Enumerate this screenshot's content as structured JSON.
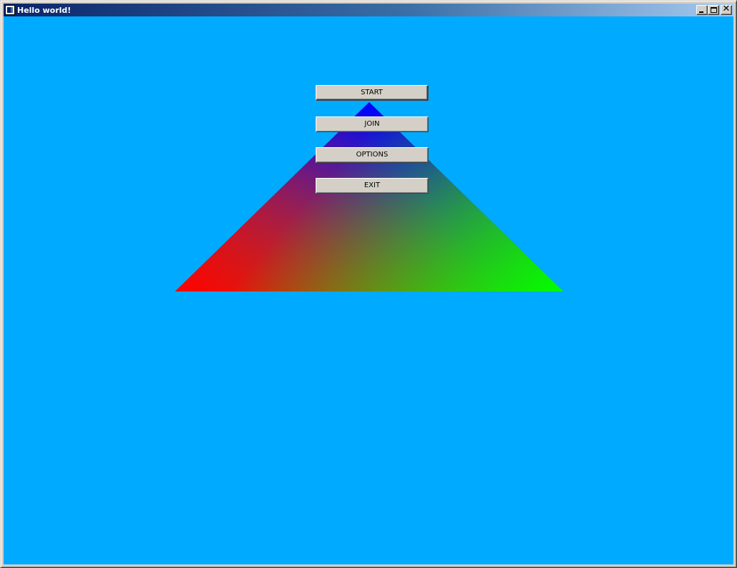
{
  "window": {
    "title": "Hello world!"
  },
  "colors": {
    "background": "#00aaff",
    "triangle_top": "#0000ff",
    "triangle_left": "#ff0000",
    "triangle_right": "#00ff00",
    "button_face": "#d4d0c8"
  },
  "menu": {
    "buttons": [
      {
        "label": "START"
      },
      {
        "label": "JOIN"
      },
      {
        "label": "OPTIONS"
      },
      {
        "label": "EXIT"
      }
    ]
  }
}
